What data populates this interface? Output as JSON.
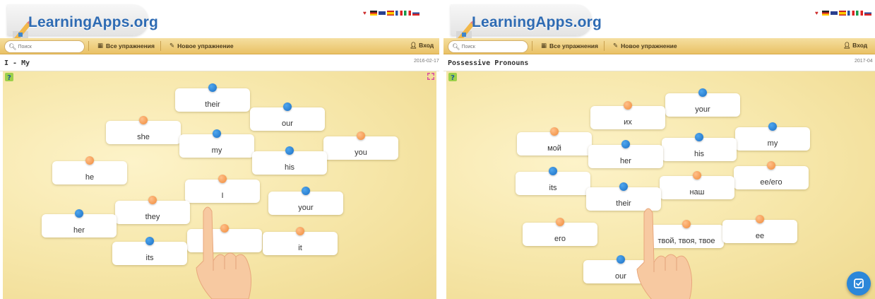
{
  "colors": {
    "accent_blue": "#2e6bb3",
    "nav_gold": "#e9c165",
    "board": "#f6e6a8",
    "dot_blue": "#1b6fc4",
    "dot_orange": "#f08a3a",
    "check_button": "#2c87d9"
  },
  "header": {
    "logo_text": "LearningApps.org",
    "logo_icon": "pencil-icon"
  },
  "nav": {
    "search_placeholder": "Поиск",
    "all_exercises": "Все упражнения",
    "new_exercise": "Новое упражнение",
    "login": "Вход"
  },
  "left": {
    "title": "I - My",
    "date": "2016-02-17",
    "cards": [
      {
        "label": "their",
        "dot": "blue"
      },
      {
        "label": "our",
        "dot": "blue"
      },
      {
        "label": "she",
        "dot": "orange"
      },
      {
        "label": "my",
        "dot": "blue"
      },
      {
        "label": "you",
        "dot": "orange"
      },
      {
        "label": "his",
        "dot": "blue"
      },
      {
        "label": "he",
        "dot": "orange"
      },
      {
        "label": "I",
        "dot": "orange"
      },
      {
        "label": "your",
        "dot": "blue"
      },
      {
        "label": "they",
        "dot": "orange"
      },
      {
        "label": "her",
        "dot": "blue"
      },
      {
        "label": "",
        "dot": "orange"
      },
      {
        "label": "it",
        "dot": "orange"
      },
      {
        "label": "its",
        "dot": "blue"
      }
    ]
  },
  "right": {
    "title": "Possessive Pronouns",
    "date": "2017-04",
    "cards": [
      {
        "label": "your",
        "dot": "blue"
      },
      {
        "label": "их",
        "dot": "orange"
      },
      {
        "label": "my",
        "dot": "blue"
      },
      {
        "label": "мой",
        "dot": "orange"
      },
      {
        "label": "his",
        "dot": "blue"
      },
      {
        "label": "her",
        "dot": "blue"
      },
      {
        "label": "ее/его",
        "dot": "orange"
      },
      {
        "label": "its",
        "dot": "blue"
      },
      {
        "label": "наш",
        "dot": "orange"
      },
      {
        "label": "their",
        "dot": "blue"
      },
      {
        "label": "его",
        "dot": "orange"
      },
      {
        "label": "твой, твоя, твое",
        "dot": "orange"
      },
      {
        "label": "ее",
        "dot": "orange"
      },
      {
        "label": "our",
        "dot": "blue"
      }
    ]
  }
}
